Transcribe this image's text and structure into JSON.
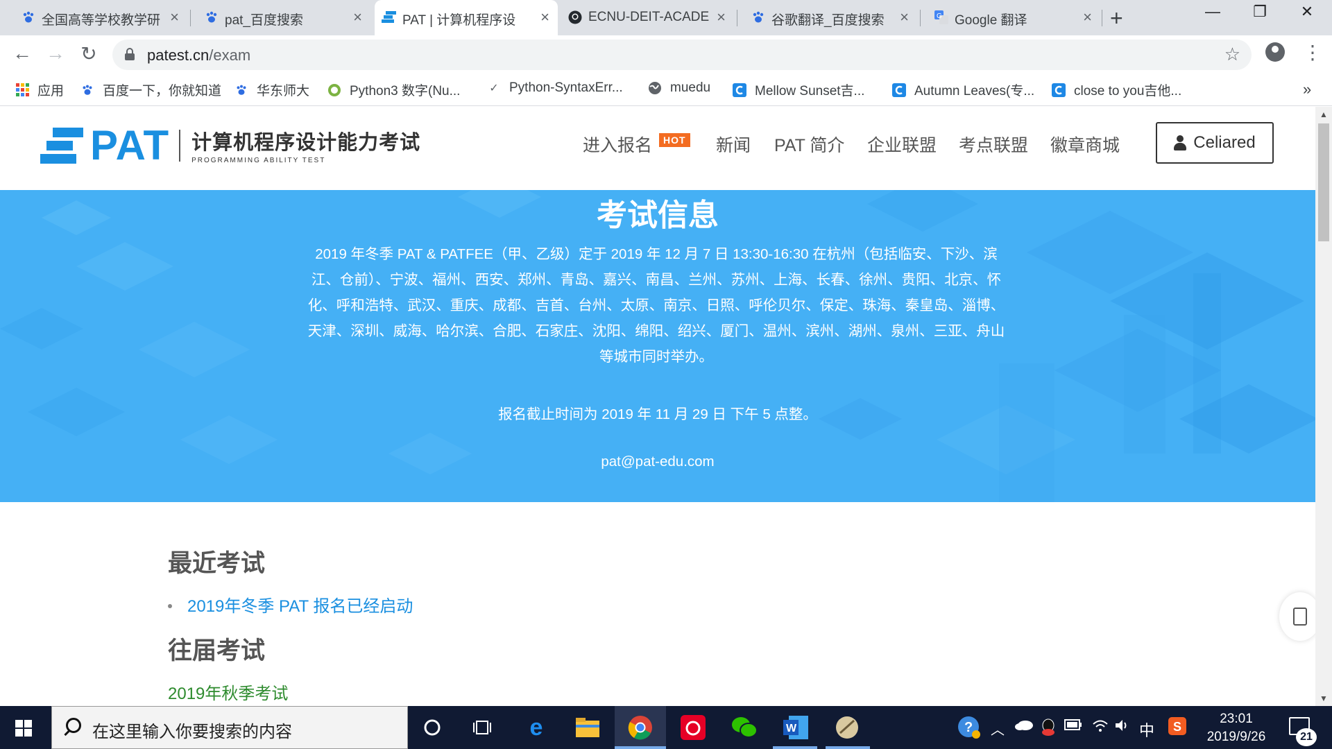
{
  "browser": {
    "tabs": [
      {
        "label": "全国高等学校教学研",
        "favicon": "paw-icon",
        "active": false
      },
      {
        "label": "pat_百度搜索",
        "favicon": "paw-icon",
        "active": false
      },
      {
        "label": "PAT | 计算机程序设",
        "favicon": "pat-icon",
        "active": true
      },
      {
        "label": "ECNU-DEIT-ACADE",
        "favicon": "github-icon",
        "active": false
      },
      {
        "label": "谷歌翻译_百度搜索",
        "favicon": "paw-icon",
        "active": false
      },
      {
        "label": "Google 翻译",
        "favicon": "google-translate-icon",
        "active": false
      }
    ],
    "url_host": "patest.cn",
    "url_path": "/exam",
    "bookmarks": [
      {
        "label": "应用",
        "icon": "apps-grid-icon"
      },
      {
        "label": "百度一下，你就知道",
        "icon": "paw-icon"
      },
      {
        "label": "华东师大",
        "icon": "paw-icon"
      },
      {
        "label": "Python3 数字(Nu...",
        "icon": "python-icon"
      },
      {
        "label": "Python-SyntaxErr...",
        "icon": "bookmark-icon"
      },
      {
        "label": "muedu",
        "icon": "globe-icon"
      },
      {
        "label": "Mellow Sunset吉...",
        "icon": "c-icon"
      },
      {
        "label": "Autumn Leaves(专...",
        "icon": "c-icon"
      },
      {
        "label": "close to you吉他...",
        "icon": "c-icon"
      }
    ],
    "more_bookmarks": "»"
  },
  "site": {
    "logo_text": "PAT",
    "logo_cn": "计算机程序设计能力考试",
    "logo_en": "PROGRAMMING ABILITY TEST",
    "nav": [
      "进入报名",
      "新闻",
      "PAT 简介",
      "企业联盟",
      "考点联盟",
      "徽章商城"
    ],
    "hot_badge": "HOT",
    "user_name": "Celiared"
  },
  "hero": {
    "title": "考试信息",
    "body": "2019 年冬季 PAT & PATFEE（甲、乙级）定于 2019 年 12 月 7 日 13:30-16:30 在杭州（包括临安、下沙、滨江、仓前）、宁波、福州、西安、郑州、青岛、嘉兴、南昌、兰州、苏州、上海、长春、徐州、贵阳、北京、怀化、呼和浩特、武汉、重庆、成都、吉首、台州、太原、南京、日照、呼伦贝尔、保定、珠海、秦皇岛、淄博、天津、深圳、威海、哈尔滨、合肥、石家庄、沈阳、绵阳、绍兴、厦门、温州、滨州、湖州、泉州、三亚、舟山等城市同时举办。",
    "deadline": "报名截止时间为 2019 年 11 月 29 日 下午 5 点整。",
    "email": "pat@pat-edu.com"
  },
  "exams": {
    "recent_heading": "最近考试",
    "recent_items": [
      "2019年冬季 PAT 报名已经启动"
    ],
    "past_heading": "往届考试",
    "past_items": [
      "2019年秋季考试"
    ]
  },
  "taskbar": {
    "search_placeholder": "在这里输入你要搜索的内容",
    "ime_label": "中",
    "time": "23:01",
    "date": "2019/9/26",
    "notification_count": "21"
  },
  "colors": {
    "brand_blue": "#1a8fe0",
    "hero_blue": "#45b0f5",
    "hot_orange": "#f36c21",
    "past_green": "#2e8b2e"
  }
}
